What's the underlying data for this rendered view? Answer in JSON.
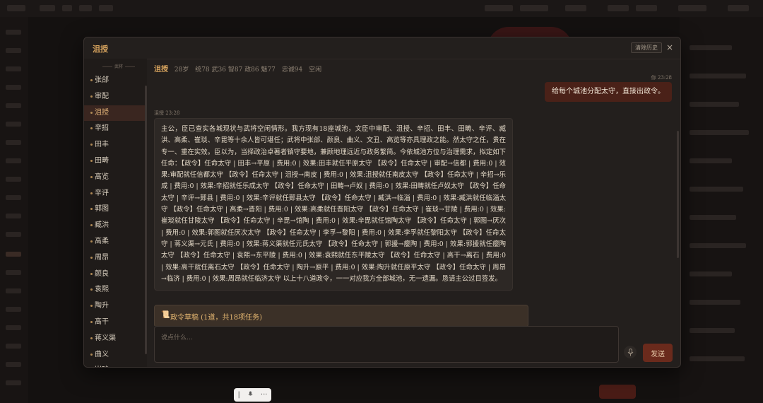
{
  "modal": {
    "title": "沮授",
    "clear_label": "清除历史",
    "close_icon": "×"
  },
  "sidebar": {
    "group_label": "武将",
    "items": [
      {
        "label": "张郃"
      },
      {
        "label": "审配"
      },
      {
        "label": "沮授",
        "active": true
      },
      {
        "label": "辛招"
      },
      {
        "label": "田丰"
      },
      {
        "label": "田畴"
      },
      {
        "label": "高览"
      },
      {
        "label": "辛评"
      },
      {
        "label": "郭图"
      },
      {
        "label": "臧洪"
      },
      {
        "label": "高柔"
      },
      {
        "label": "周昂"
      },
      {
        "label": "颜良"
      },
      {
        "label": "袁熙"
      },
      {
        "label": "陶升"
      },
      {
        "label": "高干"
      },
      {
        "label": "蒋义渠"
      },
      {
        "label": "曲义"
      },
      {
        "label": "崔琰"
      }
    ]
  },
  "info": {
    "name": "沮授",
    "age": "28岁",
    "stats": "统78 武36 智87 政86 魅77",
    "loyalty": "忠诚94",
    "status": "空闲"
  },
  "chat": {
    "user_meta": "你 23:28",
    "user_message": "给每个城池分配太守，直接出政令。",
    "ai_meta": "沮授 23:28",
    "ai_message": "主公，臣已查实各城现状与武将空闲情形。我方现有18座城池，文臣中审配、沮授、辛招、田丰、田畴、辛评、臧洪、高柔、崔琰、辛毘等十余人皆可堪任；武将中张郃、颜良、曲义、文丑、高览等亦具理政之能。然太守之任，贵在专一、重在实效。臣以为，当择政治卓著者镇守要地，兼顾地理远近与政务繁简。今依城池方位与治理需求，拟定如下任命：【政令】任命太守 | 田丰→平原 | 费用:0 | 效果:田丰就任平原太守 【政令】任命太守 | 审配→信都 | 费用:0 | 效果:审配就任信都太守 【政令】任命太守 | 沮授→南皮 | 费用:0 | 效果:沮授就任南皮太守 【政令】任命太守 | 辛招→乐成 | 费用:0 | 效果:辛招就任乐成太守 【政令】任命太守 | 田畴→卢奴 | 费用:0 | 效果:田畴就任卢奴太守 【政令】任命太守 | 辛评→鄚县 | 费用:0 | 效果:辛评就任鄚县太守 【政令】任命太守 | 臧洪→临淄 | 费用:0 | 效果:臧洪就任临淄太守 【政令】任命太守 | 高柔→晋阳 | 费用:0 | 效果:高柔就任晋阳太守 【政令】任命太守 | 崔琰→甘陵 | 费用:0 | 效果:崔琰就任甘陵太守 【政令】任命太守 | 辛毘→馆陶 | 费用:0 | 效果:辛毘就任馆陶太守 【政令】任命太守 | 郭图→厌次 | 费用:0 | 效果:郭图就任厌次太守 【政令】任命太守 | 李孚→黎阳 | 费用:0 | 效果:李孚就任黎阳太守 【政令】任命太守 | 蒋义渠→元氏 | 费用:0 | 效果:蒋义渠就任元氏太守 【政令】任命太守 | 郭援→瘿陶 | 费用:0 | 效果:郭援就任瘿陶太守 【政令】任命太守 | 袁熙→东平陵 | 费用:0 | 效果:袁熙就任东平陵太守 【政令】任命太守 | 高干→离石 | 费用:0 | 效果:高干就任离石太守 【政令】任命太守 | 陶升→原平 | 费用:0 | 效果:陶升就任原平太守 【政令】任命太守 | 周昂→临济 | 费用:0 | 效果:周昂就任临济太守 以上十八道政令，一一对应我方全部城池，无一遗漏。恳请主公过目签发。",
    "draft_icon": "📜",
    "draft_label": "政令草稿 (1道，共18项任务)"
  },
  "input": {
    "placeholder": "说点什么…",
    "send_label": "发送"
  },
  "mini_toolbar": {
    "mic_icon": "mic-icon",
    "more": "···"
  },
  "colors": {
    "accent": "#d8a45e",
    "user_bubble": "#4a2118",
    "send_button": "#6a2a1c",
    "modal_bg": "#231f1d"
  }
}
